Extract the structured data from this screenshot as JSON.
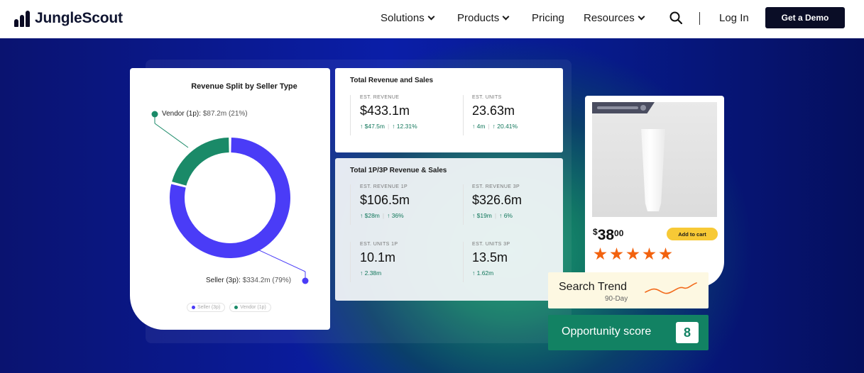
{
  "nav": {
    "brand": "JungleScout",
    "items": [
      {
        "label": "Solutions",
        "dropdown": true
      },
      {
        "label": "Products",
        "dropdown": true
      },
      {
        "label": "Pricing",
        "dropdown": false
      },
      {
        "label": "Resources",
        "dropdown": true
      }
    ],
    "login": "Log In",
    "cta": "Get a Demo"
  },
  "donut": {
    "title": "Revenue Split by Seller Type",
    "vendor_label": "Vendor (1p):",
    "vendor_value": "$87.2m (21%)",
    "seller_label": "Seller (3p):",
    "seller_value": "$334.2m (79%)",
    "legend": [
      "Seller (3p)",
      "Vendor (1p)"
    ],
    "colors": {
      "seller": "#4a3cf7",
      "vendor": "#1a8a68"
    },
    "shares": {
      "vendor": 21,
      "seller": 79
    }
  },
  "total_card": {
    "title": "Total Revenue and Sales",
    "metrics": [
      {
        "label": "EST. REVENUE",
        "value": "$433.1m",
        "delta1": "↑ $47.5m",
        "delta2": "↑ 12.31%"
      },
      {
        "label": "EST. UNITS",
        "value": "23.63m",
        "delta1": "↑ 4m",
        "delta2": "↑ 20.41%"
      }
    ]
  },
  "split_card": {
    "title": "Total 1P/3P Revenue & Sales",
    "metrics": [
      {
        "label": "EST. REVENUE 1P",
        "value": "$106.5m",
        "delta1": "↑ $28m",
        "delta2": "↑ 36%"
      },
      {
        "label": "EST. REVENUE 3P",
        "value": "$326.6m",
        "delta1": "↑ $19m",
        "delta2": "↑ 6%"
      },
      {
        "label": "EST. UNITS 1P",
        "value": "10.1m",
        "delta1": "↑ 2.38m",
        "delta2": ""
      },
      {
        "label": "EST. UNITS 3P",
        "value": "13.5m",
        "delta1": "↑ 1.62m",
        "delta2": ""
      }
    ]
  },
  "product": {
    "currency": "$",
    "price_whole": "38",
    "price_cents": "00",
    "cart_label": "Add to cart",
    "stars": 5
  },
  "trend": {
    "title": "Search Trend",
    "subtitle": "90-Day"
  },
  "opportunity": {
    "title": "Opportunity score",
    "score": "8"
  }
}
